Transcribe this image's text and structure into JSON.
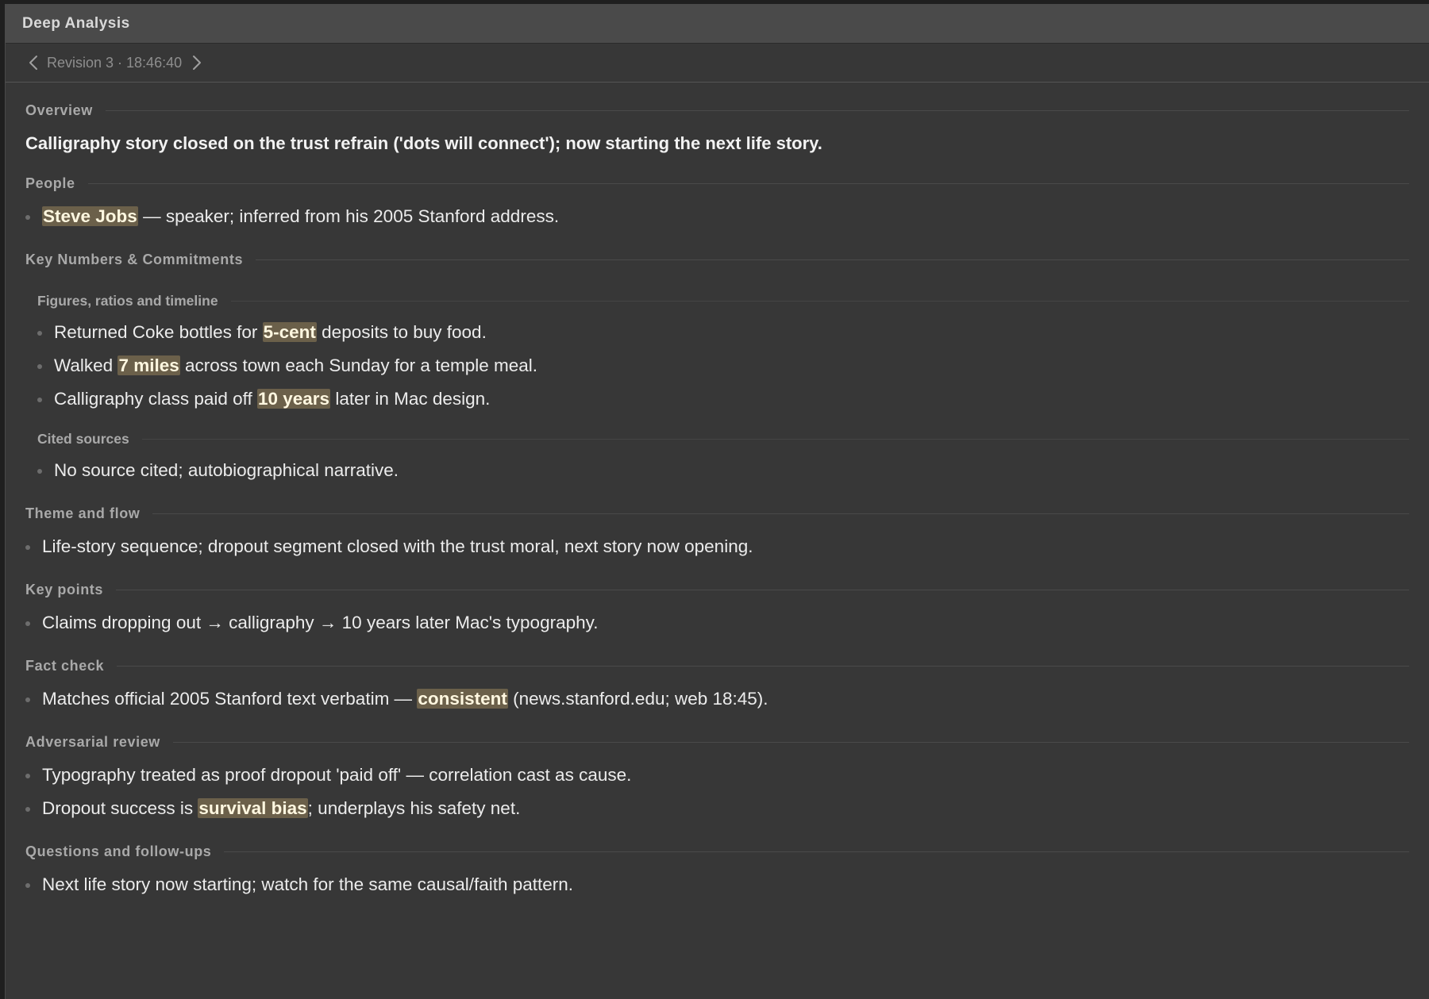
{
  "window": {
    "title": "Deep Analysis"
  },
  "revision": {
    "label": "Revision 3 · 18:46:40"
  },
  "overview": {
    "heading": "Overview",
    "text": "Calligraphy story closed on the trust refrain ('dots will connect'); now starting the next life story."
  },
  "people": {
    "heading": "People",
    "items": [
      {
        "highlight": "Steve Jobs",
        "rest": " — speaker; inferred from his 2005 Stanford address."
      }
    ]
  },
  "numbers": {
    "heading": "Key Numbers & Commitments",
    "figures": {
      "heading": "Figures, ratios and timeline",
      "items": [
        {
          "pre": "Returned Coke bottles for ",
          "highlight": "5-cent",
          "post": " deposits to buy food."
        },
        {
          "pre": "Walked ",
          "highlight": "7 miles",
          "post": " across town each Sunday for a temple meal."
        },
        {
          "pre": "Calligraphy class paid off ",
          "highlight": "10 years",
          "post": " later in Mac design."
        }
      ]
    },
    "sources": {
      "heading": "Cited sources",
      "items": [
        "No source cited; autobiographical narrative."
      ]
    }
  },
  "theme": {
    "heading": "Theme and flow",
    "items": [
      "Life-story sequence; dropout segment closed with the trust moral, next story now opening."
    ]
  },
  "key_points": {
    "heading": "Key points",
    "items": [
      "Claims dropping out → calligraphy → 10 years later Mac's typography."
    ]
  },
  "fact_check": {
    "heading": "Fact check",
    "items": [
      {
        "pre": "Matches official 2005 Stanford text verbatim — ",
        "highlight": "consistent",
        "post": " (news.stanford.edu; web 18:45)."
      }
    ]
  },
  "adversarial": {
    "heading": "Adversarial review",
    "items": [
      {
        "pre": "Typography treated as proof dropout 'paid off' — correlation cast as cause.",
        "highlight": "",
        "post": ""
      },
      {
        "pre": "Dropout success is ",
        "highlight": "survival bias",
        "post": "; underplays his safety net."
      }
    ]
  },
  "questions": {
    "heading": "Questions and follow-ups",
    "items": [
      "Next life story now starting; watch for the same causal/faith pattern."
    ]
  },
  "colors": {
    "panel_bg": "#373737",
    "titlebar_bg": "#4a4a4a",
    "highlight_bg": "#6b604a"
  }
}
